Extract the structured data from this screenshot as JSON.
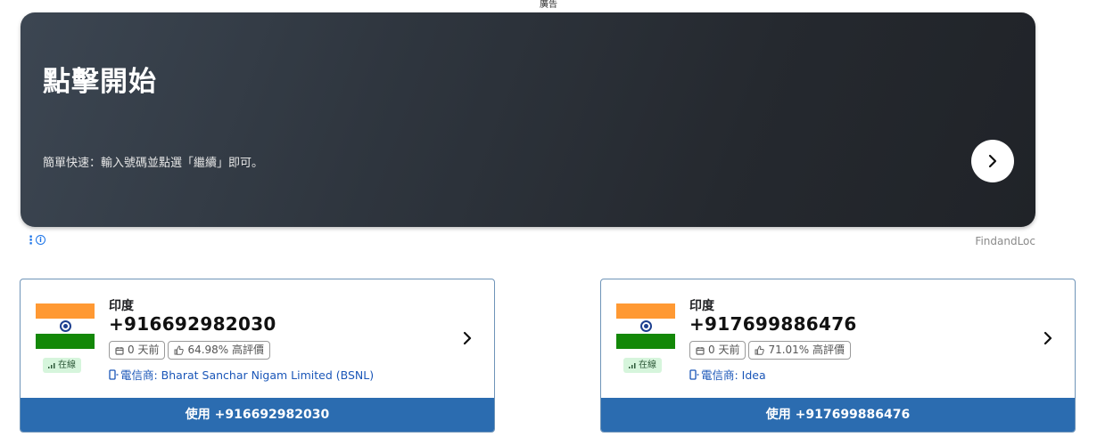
{
  "ad": {
    "label": "廣告",
    "title": "點擊開始",
    "description": "簡單快速：輸入號碼並點選「繼續」即可。",
    "brand": "FindandLoc"
  },
  "cards": [
    {
      "country": "印度",
      "number": "+916692982030",
      "status": "在線",
      "age": "0 天前",
      "rating": "64.98% 高評價",
      "carrier": "電信商: Bharat Sanchar Nigam Limited (BSNL)",
      "use_label": "使用 +916692982030"
    },
    {
      "country": "印度",
      "number": "+917699886476",
      "status": "在線",
      "age": "0 天前",
      "rating": "71.01% 高評價",
      "carrier": "電信商: Idea",
      "use_label": "使用 +917699886476"
    }
  ],
  "colors": {
    "accent": "#2b6cb0",
    "online_bg": "#d6f5dc",
    "carrier_link": "#1a56b8"
  },
  "icons": [
    "chevron-right-icon",
    "calendar-icon",
    "thumbs-up-icon",
    "signal-icon",
    "phone-icon",
    "info-icon",
    "more-vertical-icon"
  ]
}
